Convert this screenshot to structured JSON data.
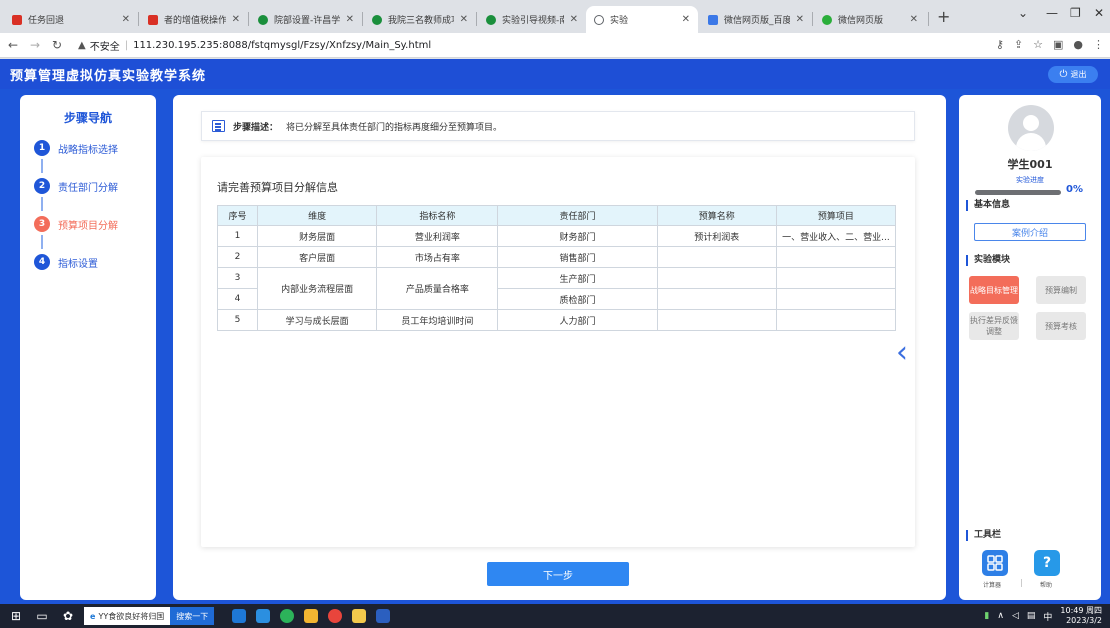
{
  "browser": {
    "tabs": [
      {
        "label": "任务回退",
        "color": "#d93025"
      },
      {
        "label": "者的增值税操作步",
        "color": "#d93025"
      },
      {
        "label": "院部设置-许昌学院",
        "color": "#1a8f3c"
      },
      {
        "label": "我院三名教师成功",
        "color": "#1a8f3c"
      },
      {
        "label": "实验引导视频-南宁",
        "color": "#1a8f3c"
      },
      {
        "label": "实验",
        "color": "#5f6368"
      },
      {
        "label": "微信网页版_百度搜",
        "color": "#3b78e7"
      },
      {
        "label": "微信网页版",
        "color": "#2aae3a"
      }
    ],
    "address": {
      "security_text": "不安全",
      "url": "111.230.195.235:8088/fstqmysgl/Fzsy/Xnfzsy/Main_Sy.html"
    }
  },
  "app": {
    "title": "预算管理虚拟仿真实验教学系统",
    "logout_label": "退出"
  },
  "steps": {
    "title": "步骤导航",
    "items": [
      {
        "num": "1",
        "label": "战略指标选择",
        "state": "done"
      },
      {
        "num": "2",
        "label": "责任部门分解",
        "state": "done"
      },
      {
        "num": "3",
        "label": "预算项目分解",
        "state": "current"
      },
      {
        "num": "4",
        "label": "指标设置",
        "state": "todo"
      }
    ]
  },
  "main": {
    "desc_label": "步骤描述：",
    "desc_text": "将已分解至具体责任部门的指标再度细分至预算项目。",
    "card_title": "请完善预算项目分解信息",
    "table": {
      "headers": [
        "序号",
        "维度",
        "指标名称",
        "责任部门",
        "预算名称",
        "预算项目"
      ],
      "rows": [
        {
          "no": "1",
          "dimension": "财务层面",
          "indicator": "营业利润率",
          "dept": "财务部门",
          "budget_name": "预计利润表",
          "budget_item": "一、营业收入、二、营业..."
        },
        {
          "no": "2",
          "dimension": "客户层面",
          "indicator": "市场占有率",
          "dept": "销售部门",
          "budget_name": "",
          "budget_item": ""
        },
        {
          "no": "3",
          "dimension": "内部业务流程层面",
          "indicator": "产品质量合格率",
          "dept": "生产部门",
          "budget_name": "",
          "budget_item": ""
        },
        {
          "no": "4",
          "dimension": "",
          "indicator": "",
          "dept": "质检部门",
          "budget_name": "",
          "budget_item": ""
        },
        {
          "no": "5",
          "dimension": "学习与成长层面",
          "indicator": "员工年均培训时间",
          "dept": "人力部门",
          "budget_name": "",
          "budget_item": ""
        }
      ]
    },
    "next_label": "下一步"
  },
  "right": {
    "student_name": "学生001",
    "progress_label": "实验进度",
    "progress_value": 0,
    "progress_text": "0%",
    "basic_info_title": "基本信息",
    "case_button": "案例介绍",
    "modules_title": "实验模块",
    "modules": [
      {
        "label": "战略目标管理",
        "active": true
      },
      {
        "label": "预算编制",
        "active": false
      },
      {
        "label": "执行差异反馈调整",
        "active": false
      },
      {
        "label": "预算考核",
        "active": false
      }
    ],
    "toolbar_title": "工具栏",
    "tools": [
      {
        "label": "计算器",
        "icon": "calculator-icon"
      },
      {
        "label": "帮助",
        "icon": "help-icon"
      }
    ]
  },
  "taskbar": {
    "search_text": "YY食欲良好将归国",
    "search_button": "搜索一下",
    "time": "10:49 周四",
    "date": "2023/3/2",
    "ime": "中"
  }
}
